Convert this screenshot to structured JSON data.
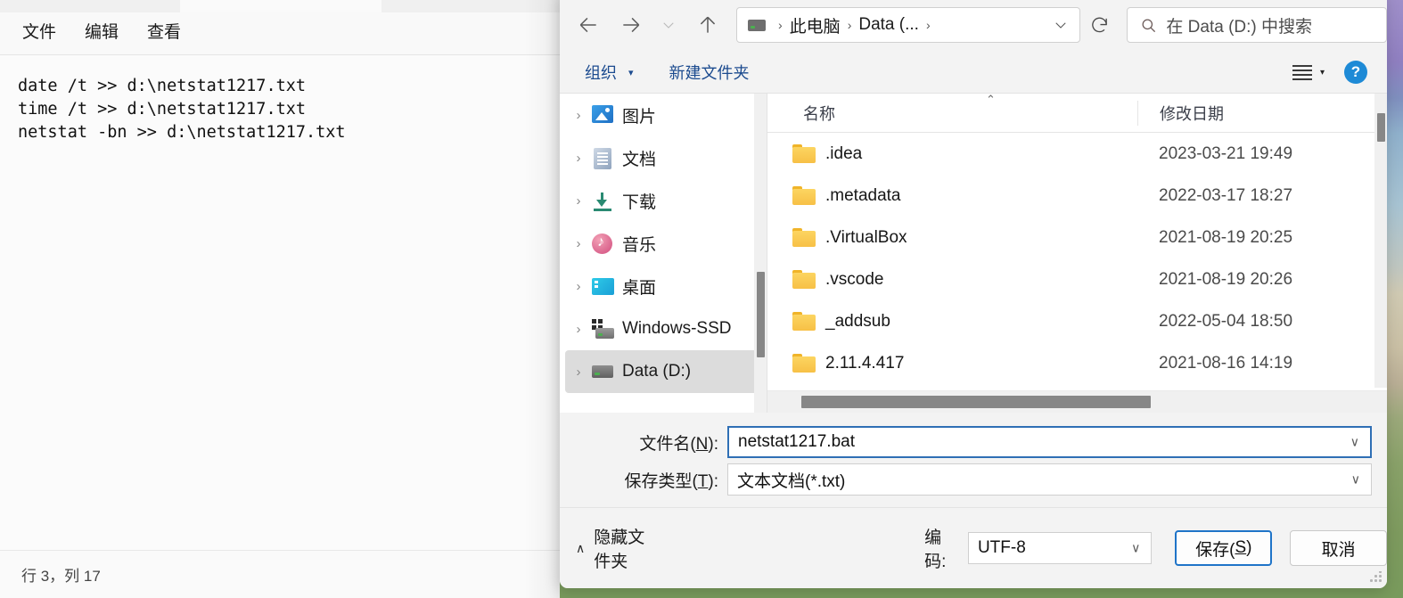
{
  "notepad": {
    "tabs": [
      {
        "name": "tab-1",
        "active": true,
        "accent_color": "#a8500c"
      },
      {
        "name": "tab-2",
        "active": false
      }
    ],
    "menu": [
      {
        "label": "文件"
      },
      {
        "label": "编辑"
      },
      {
        "label": "查看"
      }
    ],
    "editor_text": "date /t >> d:\\netstat1217.txt\ntime /t >> d:\\netstat1217.txt\nnetstat -bn >> d:\\netstat1217.txt",
    "status": "行 3，列 17"
  },
  "dialog": {
    "nav": {
      "back_icon": "arrow-left-icon",
      "forward_icon": "arrow-right-icon",
      "recent_icon": "chevron-down-icon",
      "up_icon": "arrow-up-icon",
      "refresh_icon": "refresh-icon",
      "expand_icon": "chevron-down-icon"
    },
    "breadcrumb": {
      "drive_icon": "drive-icon",
      "segments": [
        "此电脑",
        "Data (..."
      ],
      "separator": "›",
      "trailing_separator": "›"
    },
    "search": {
      "icon": "search-icon",
      "placeholder": "在 Data (D:) 中搜索"
    },
    "command_bar": {
      "organize": "组织",
      "organize_caret": "▾",
      "new_folder": "新建文件夹",
      "view_icon": "list-view-icon",
      "view_caret": "▾",
      "help_icon": "help-icon",
      "help_label": "?"
    },
    "tree": {
      "items": [
        {
          "label": "图片",
          "icon": "pictures-icon",
          "chevron": "›",
          "selected": false
        },
        {
          "label": "文档",
          "icon": "documents-icon",
          "chevron": "›",
          "selected": false
        },
        {
          "label": "下载",
          "icon": "downloads-icon",
          "chevron": "›",
          "selected": false
        },
        {
          "label": "音乐",
          "icon": "music-icon",
          "chevron": "›",
          "selected": false
        },
        {
          "label": "桌面",
          "icon": "desktop-icon",
          "chevron": "›",
          "selected": false
        },
        {
          "label": "Windows-SSD",
          "icon": "ssd-drive-icon",
          "chevron": "›",
          "selected": false
        },
        {
          "label": "Data (D:)",
          "icon": "drive-icon",
          "chevron": "›",
          "selected": true
        }
      ]
    },
    "list": {
      "columns": [
        {
          "label": "名称",
          "sorted": "asc",
          "sort_glyph": "⌃"
        },
        {
          "label": "修改日期"
        }
      ],
      "rows": [
        {
          "icon": "folder-icon",
          "name": ".idea",
          "date": "2023-03-21 19:49"
        },
        {
          "icon": "folder-icon",
          "name": ".metadata",
          "date": "2022-03-17 18:27"
        },
        {
          "icon": "folder-icon",
          "name": ".VirtualBox",
          "date": "2021-08-19 20:25"
        },
        {
          "icon": "folder-icon",
          "name": ".vscode",
          "date": "2021-08-19 20:26"
        },
        {
          "icon": "folder-icon",
          "name": "_addsub",
          "date": "2022-05-04 18:50"
        },
        {
          "icon": "folder-icon",
          "name": "2.11.4.417",
          "date": "2021-08-16 14:19"
        }
      ]
    },
    "form": {
      "filename_label_pre": "文件名(",
      "filename_label_key": "N",
      "filename_label_post": "):",
      "filename_value": "netstat1217.bat",
      "filetype_label_pre": "保存类型(",
      "filetype_label_key": "T",
      "filetype_label_post": "):",
      "filetype_value": "文本文档(*.txt)",
      "caret": "∨"
    },
    "footer": {
      "hide_folders_caret": "∧",
      "hide_folders_label": "隐藏文件夹",
      "encoding_label": "编码:",
      "encoding_value": "UTF-8",
      "encoding_caret": "∨",
      "save_label_pre": "保存(",
      "save_label_key": "S",
      "save_label_post": ")",
      "cancel_label": "取消"
    }
  }
}
